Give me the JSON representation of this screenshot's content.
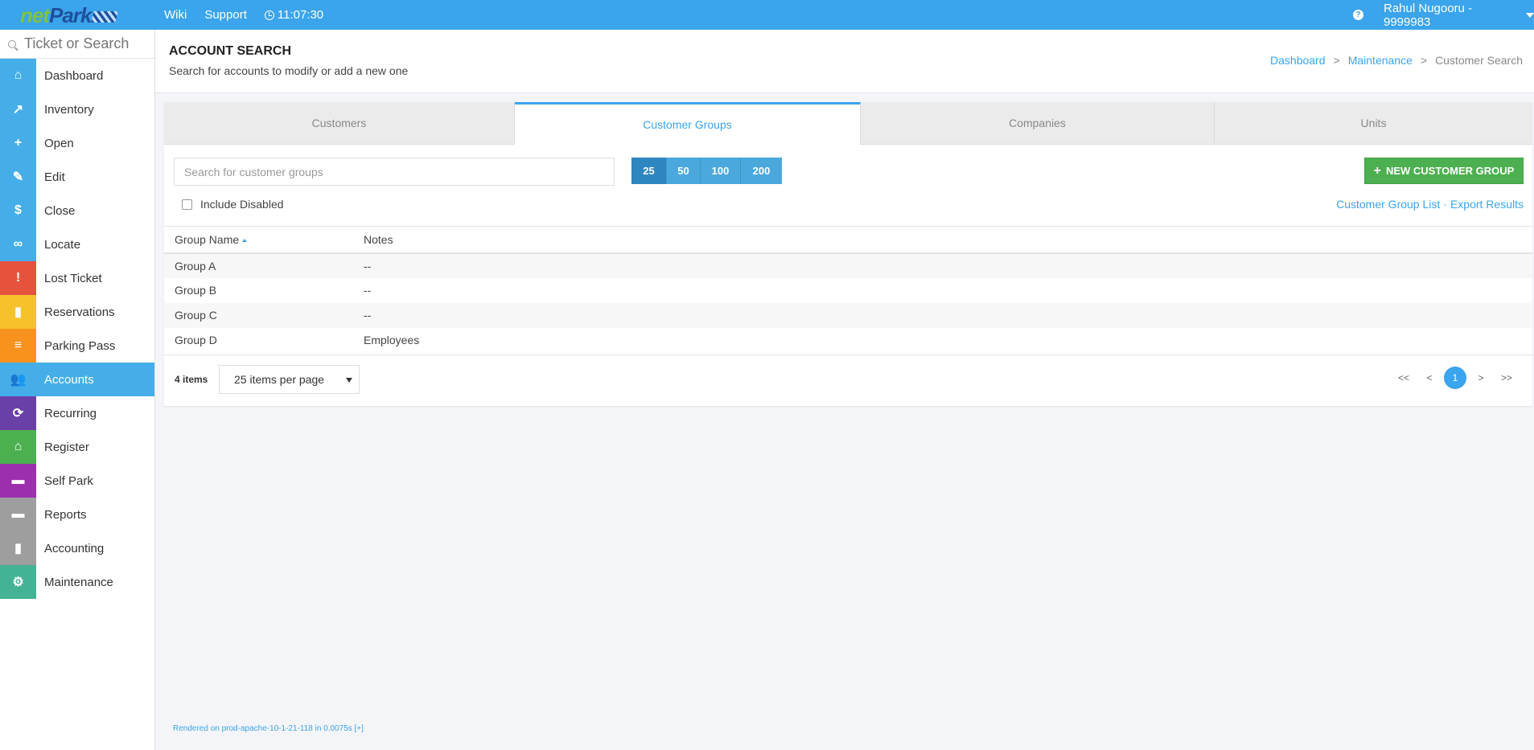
{
  "brand": {
    "net": "net",
    "park": "Park"
  },
  "topnav": {
    "wiki": "Wiki",
    "support": "Support",
    "time": "11:07:30"
  },
  "user": {
    "name": "Rahul Nugooru - 9999983"
  },
  "sidebar": {
    "search_placeholder": "Ticket or Search",
    "items": [
      {
        "label": "Dashboard",
        "icon": "home-icon",
        "color": "#45aee8"
      },
      {
        "label": "Inventory",
        "icon": "trend-chart-icon",
        "color": "#45aee8"
      },
      {
        "label": "Open",
        "icon": "plus-icon",
        "color": "#45aee8"
      },
      {
        "label": "Edit",
        "icon": "pencil-icon",
        "color": "#45aee8"
      },
      {
        "label": "Close",
        "icon": "dollar-icon",
        "color": "#45aee8"
      },
      {
        "label": "Locate",
        "icon": "binoculars-icon",
        "color": "#45aee8"
      },
      {
        "label": "Lost Ticket",
        "icon": "alert-icon",
        "color": "#e5533d"
      },
      {
        "label": "Reservations",
        "icon": "document-icon",
        "color": "#f6c22c"
      },
      {
        "label": "Parking Pass",
        "icon": "list-icon",
        "color": "#f7921e"
      },
      {
        "label": "Accounts",
        "icon": "users-icon",
        "color": "#45aee8"
      },
      {
        "label": "Recurring",
        "icon": "refresh-icon",
        "color": "#6b3fa8"
      },
      {
        "label": "Register",
        "icon": "bank-icon",
        "color": "#4cb050"
      },
      {
        "label": "Self Park",
        "icon": "car-icon",
        "color": "#9b2fae"
      },
      {
        "label": "Reports",
        "icon": "folder-icon",
        "color": "#9e9e9e"
      },
      {
        "label": "Accounting",
        "icon": "bar-chart-icon",
        "color": "#9e9e9e"
      },
      {
        "label": "Maintenance",
        "icon": "gear-icon",
        "color": "#44b295"
      }
    ]
  },
  "header": {
    "title": "ACCOUNT SEARCH",
    "subtitle": "Search for accounts to modify or add a new one",
    "breadcrumb": [
      "Dashboard",
      "Maintenance",
      "Customer Search"
    ]
  },
  "tabs": [
    {
      "label": "Customers"
    },
    {
      "label": "Customer Groups"
    },
    {
      "label": "Companies"
    },
    {
      "label": "Units"
    }
  ],
  "toolbar": {
    "search_placeholder": "Search for customer groups",
    "page_sizes": [
      "25",
      "50",
      "100",
      "200"
    ],
    "new_button": "NEW CUSTOMER GROUP",
    "include_disabled": "Include Disabled",
    "link_list": "Customer Group List",
    "link_sep": "·",
    "link_export": "Export Results"
  },
  "table": {
    "columns": [
      "Group Name",
      "Notes"
    ],
    "rows": [
      [
        "Group A",
        "--"
      ],
      [
        "Group B",
        "--"
      ],
      [
        "Group C",
        "--"
      ],
      [
        "Group D",
        "Employees"
      ]
    ]
  },
  "footer": {
    "items": "4 items",
    "per_page": "25 items per page",
    "pagination": [
      "<<",
      "<",
      "1",
      ">",
      ">>"
    ]
  },
  "rendered": "Rendered on prod-apache-10-1-21-118 in 0.0075s [+]"
}
